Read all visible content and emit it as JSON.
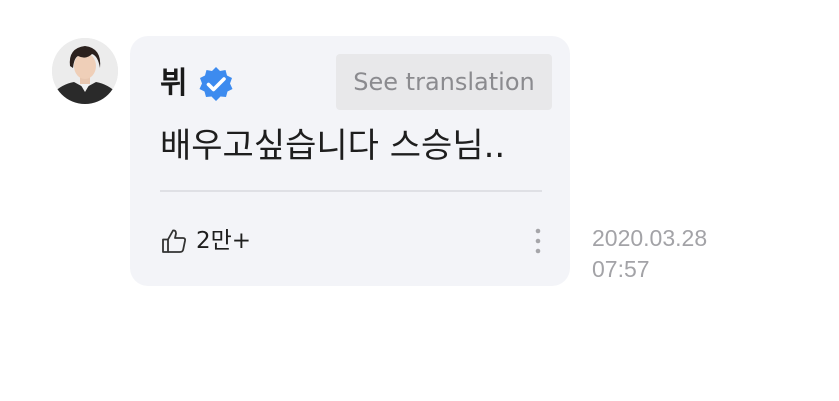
{
  "comment": {
    "author": "뷔",
    "verified_icon": "verified-badge-icon",
    "translate_button_label": "See translation",
    "message": "배우고싶습니다 스승님..",
    "like_count": "2만+",
    "date": "2020.03.28",
    "time": "07:57"
  },
  "icons": {
    "like": "thumbs-up-icon",
    "more": "more-vertical-icon",
    "avatar": "avatar"
  },
  "colors": {
    "bubble_background": "#f3f4f8",
    "verified_badge": "#3d8bef",
    "translate_button_background": "#e8e8ea",
    "timestamp_text": "#a3a3a7"
  }
}
